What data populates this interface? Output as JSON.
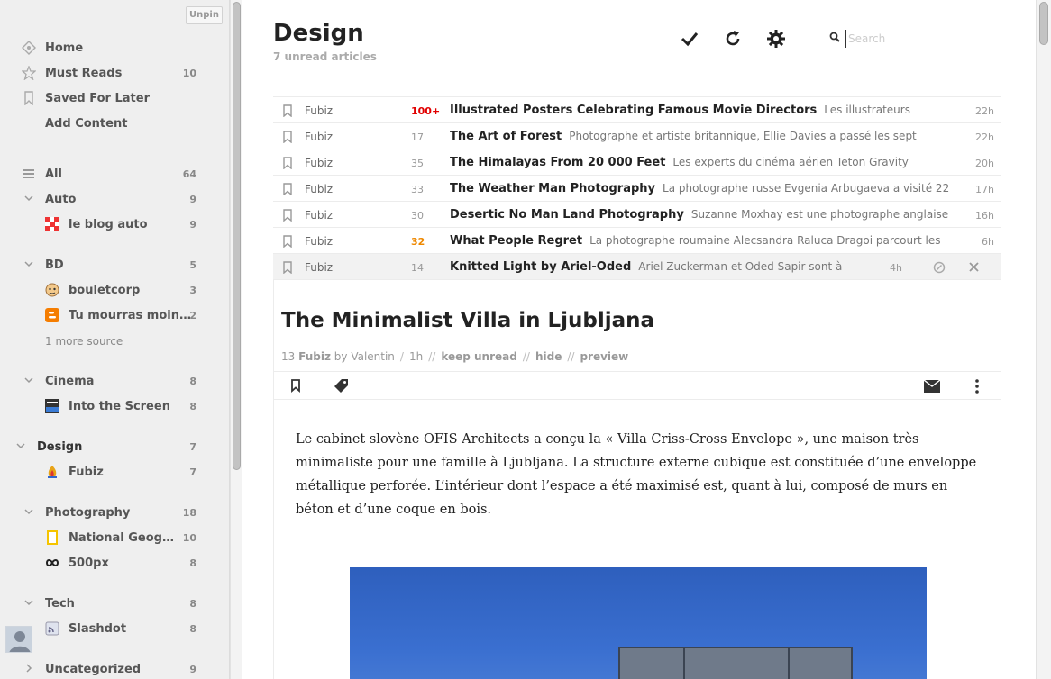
{
  "sidebar": {
    "unpin_label": "Unpin",
    "top": [
      {
        "name": "home",
        "label": "Home",
        "count": ""
      },
      {
        "name": "must-reads",
        "label": "Must Reads",
        "count": "10"
      },
      {
        "name": "saved-for-later",
        "label": "Saved For Later",
        "count": ""
      },
      {
        "name": "add-content",
        "label": "Add Content",
        "count": ""
      }
    ],
    "all": {
      "label": "All",
      "count": "64"
    },
    "categories": [
      {
        "label": "Auto",
        "count": "9",
        "sources": [
          {
            "label": "le blog auto",
            "count": "9",
            "icon": "checker-favicon"
          }
        ]
      },
      {
        "label": "BD",
        "count": "5",
        "sources": [
          {
            "label": "bouletcorp",
            "count": "3",
            "icon": "face-favicon"
          },
          {
            "label": "Tu mourras moins bête",
            "count": "2",
            "icon": "blogger-favicon"
          }
        ],
        "more": "1 more source"
      },
      {
        "label": "Cinema",
        "count": "8",
        "sources": [
          {
            "label": "Into the Screen",
            "count": "8",
            "icon": "into-screen-favicon"
          }
        ]
      },
      {
        "label": "Design",
        "count": "7",
        "sources": [
          {
            "label": "Fubiz",
            "count": "7",
            "icon": "fubiz-favicon"
          }
        ]
      },
      {
        "label": "Photography",
        "count": "18",
        "sources": [
          {
            "label": "National Geographic",
            "count": "10",
            "icon": "natgeo-favicon"
          },
          {
            "label": "500px",
            "count": "8",
            "icon": "infinity-favicon"
          }
        ]
      },
      {
        "label": "Tech",
        "count": "8",
        "sources": [
          {
            "label": "Slashdot",
            "count": "8",
            "icon": "rss-favicon"
          }
        ]
      },
      {
        "label": "Uncategorized",
        "count": "9",
        "sources": []
      }
    ]
  },
  "header": {
    "title": "Design",
    "unread": "7 unread articles",
    "search_placeholder": "Search"
  },
  "articles": [
    {
      "source": "Fubiz",
      "popularity": "100+",
      "title": "Illustrated Posters Celebrating Famous Movie Directors",
      "snippet": "Les illustrateurs",
      "age": "22h"
    },
    {
      "source": "Fubiz",
      "popularity": "17",
      "title": "The Art of Forest",
      "snippet": "Photographe et artiste britannique, Ellie Davies a passé les sept",
      "age": "22h"
    },
    {
      "source": "Fubiz",
      "popularity": "35",
      "title": "The Himalayas From 20 000 Feet",
      "snippet": "Les experts du cinéma aérien Teton Gravity",
      "age": "20h"
    },
    {
      "source": "Fubiz",
      "popularity": "33",
      "title": "The Weather Man Photography",
      "snippet": "La photographe russe Evgenia Arbugaeva a visité 22",
      "age": "17h"
    },
    {
      "source": "Fubiz",
      "popularity": "30",
      "title": "Desertic No Man Land Photography",
      "snippet": "Suzanne Moxhay est une photographe anglaise",
      "age": "16h"
    },
    {
      "source": "Fubiz",
      "popularity": "32",
      "title": "What People Regret",
      "snippet": "La photographe roumaine Alecsandra Raluca Dragoi parcourt les",
      "age": "6h"
    },
    {
      "source": "Fubiz",
      "popularity": "14",
      "title": "Knitted Light by Ariel-Oded",
      "snippet": "Ariel Zuckerman et Oded Sapir sont à",
      "age": "4h"
    }
  ],
  "entry": {
    "title": "The Minimalist Villa in Ljubljana",
    "count": "13",
    "source": "Fubiz",
    "by": "by Valentin",
    "age": "1h",
    "keep_unread": "keep unread",
    "hide": "hide",
    "preview": "preview",
    "sep1": "/",
    "sep2": "//",
    "body": "Le cabinet slovène OFIS Architects a conçu la « Villa Criss-Cross Envelope », une maison très minimaliste pour une famille à Ljubljana. La structure externe cubique est constituée d’une enveloppe métallique perforée. L’intérieur dont l’espace a été maximisé est, quant à lui, composé de murs en béton et d’une coque en bois."
  },
  "colors": {
    "hot": "#e10000",
    "warm": "#ee8800",
    "sidebar_bg": "#efefef"
  }
}
